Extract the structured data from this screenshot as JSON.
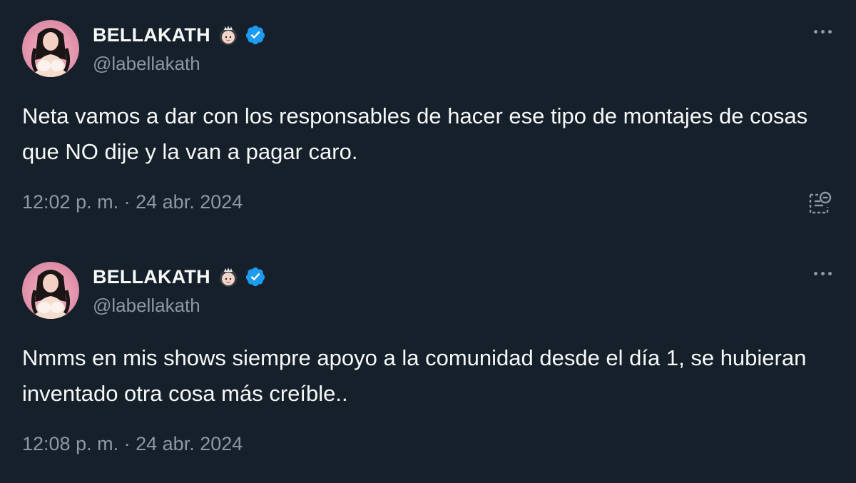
{
  "tweets": [
    {
      "author": {
        "name": "BELLAKATH",
        "handle": "@labellakath",
        "name_emoji": "princess-emoji",
        "verified": true,
        "verified_color": "#1d9bf0"
      },
      "text": "Neta vamos a dar con los responsables de hacer ese tipo de montajes de cosas que NO dije y la van a pagar caro.",
      "time": "12:02 p. m.",
      "separator": "·",
      "date": "24 abr. 2024",
      "more_icon": "more-options-icon",
      "note_icon": "community-note-icon"
    },
    {
      "author": {
        "name": "BELLAKATH",
        "handle": "@labellakath",
        "name_emoji": "princess-emoji",
        "verified": true,
        "verified_color": "#1d9bf0"
      },
      "text": "Nmms en mis shows siempre apoyo a la comunidad desde el día 1, se hubieran inventado otra cosa más creíble..",
      "time": "12:08 p. m.",
      "separator": "·",
      "date": "24 abr. 2024",
      "more_icon": "more-options-icon"
    }
  ],
  "colors": {
    "background": "#15202b",
    "text_primary": "#f7f9f9",
    "text_secondary": "#8b98a5",
    "verified": "#1d9bf0"
  }
}
